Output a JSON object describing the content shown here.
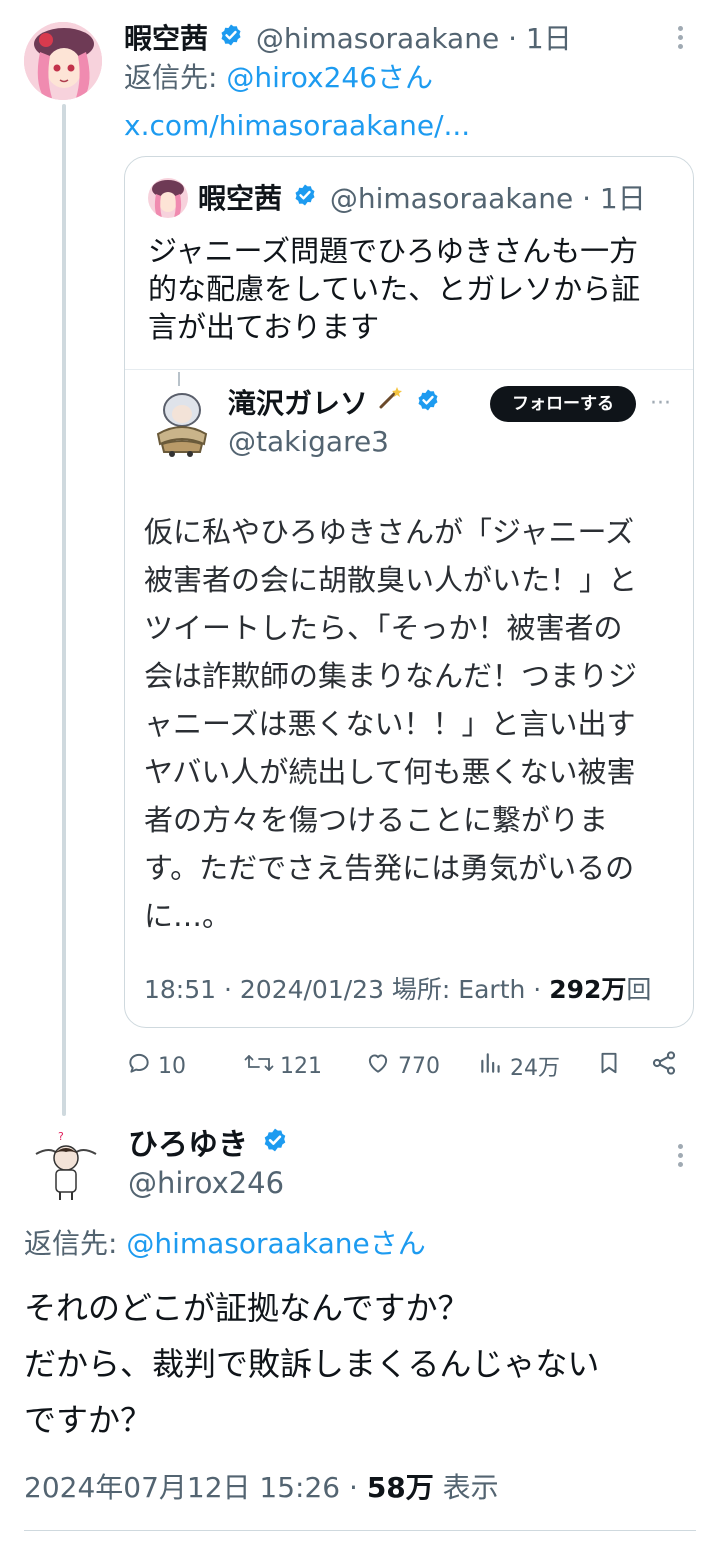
{
  "tweet1": {
    "display_name": "暇空茜",
    "handle": "@himasoraakane",
    "time": "1日",
    "reply_prefix": "返信先: ",
    "reply_to": "@hirox246さん",
    "link": "x.com/himasoraakane/..."
  },
  "quote": {
    "display_name": "暇空茜",
    "handle": "@himasoraakane",
    "time": "1日",
    "text_lines": [
      "ジャニーズ問題でひろゆきさんも一方",
      "的な配慮をしていた、とガレソから証",
      "言が出ております"
    ]
  },
  "embedded": {
    "display_name": "滝沢ガレソ",
    "handle": "@takigare3",
    "follow_label": "フォローする",
    "more": "···",
    "text_lines": [
      "仮に私やひろゆきさんが「ジャニーズ",
      "被害者の会に胡散臭い人がいた！」と",
      "ツイートしたら、「そっか！被害者の",
      "会は詐欺師の集まりなんだ！つまりジ",
      "ャニーズは悪くない！！」と言い出す",
      "ヤバい人が続出して何も悪くない被害",
      "者の方々を傷つけることに繋がりま",
      "す。ただでさえ告発には勇気がいるの",
      "に…。"
    ],
    "meta_time": "18:51 · 2024/01/23 場所: Earth · ",
    "meta_views": "292万",
    "meta_views_unit": "回"
  },
  "actions": {
    "replies": "10",
    "retweets": "121",
    "likes": "770",
    "views": "24万"
  },
  "tweet2": {
    "display_name": "ひろゆき",
    "handle": "@hirox246",
    "reply_prefix": "返信先: ",
    "reply_to": "@himasoraakaneさん",
    "text_lines": [
      "それのどこが証拠なんですか？",
      "だから、裁判で敗訴しまくるんじゃない",
      "ですか？"
    ],
    "timestamp": "2024年07月12日 15:26 · ",
    "views": "58万",
    "views_label": " 表示"
  },
  "colors": {
    "accent": "#1d9bf0",
    "text": "#0f1419",
    "muted": "#536471",
    "border": "#cfd9de"
  }
}
